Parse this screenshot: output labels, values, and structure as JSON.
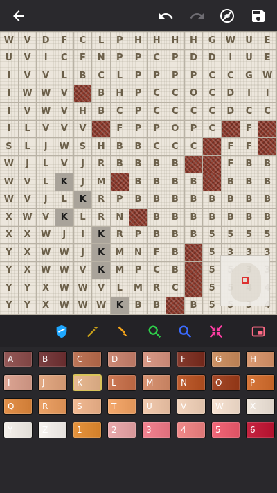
{
  "toolbar": {
    "back_icon": "arrow-left-icon",
    "undo_icon": "undo-icon",
    "redo_icon": "redo-icon",
    "hide_icon": "no-eye-icon",
    "save_icon": "save-icon"
  },
  "grid": {
    "rows": [
      [
        "W",
        "V",
        "D",
        "F",
        "C",
        "L",
        "P",
        "H",
        "H",
        "H",
        "H",
        "G",
        "W",
        "U",
        "E"
      ],
      [
        "U",
        "V",
        "I",
        "C",
        "F",
        "N",
        "P",
        "P",
        "C",
        "P",
        "D",
        "D",
        "I",
        "U",
        "E"
      ],
      [
        "I",
        "V",
        "V",
        "L",
        "B",
        "C",
        "L",
        "P",
        "P",
        "P",
        "P",
        "C",
        "C",
        "G",
        "W"
      ],
      [
        "I",
        "W",
        "W",
        "V",
        "",
        "B",
        "H",
        "P",
        "C",
        "C",
        "O",
        "C",
        "D",
        "I",
        "I"
      ],
      [
        "I",
        "V",
        "W",
        "V",
        "H",
        "B",
        "C",
        "P",
        "C",
        "C",
        "C",
        "C",
        "D",
        "C",
        "C"
      ],
      [
        "I",
        "L",
        "V",
        "V",
        "V",
        "",
        "F",
        "P",
        "P",
        "O",
        "P",
        "C",
        "",
        "F",
        ""
      ],
      [
        "S",
        "L",
        "J",
        "W",
        "S",
        "H",
        "B",
        "B",
        "C",
        "C",
        "C",
        "",
        "F",
        "F",
        ""
      ],
      [
        "W",
        "J",
        "L",
        "V",
        "J",
        "R",
        "B",
        "B",
        "B",
        "B",
        "",
        "",
        "F",
        "B",
        "B"
      ],
      [
        "W",
        "V",
        "L",
        "K",
        "J",
        "M",
        "",
        "B",
        "B",
        "B",
        "B",
        "",
        "B",
        "B",
        "B"
      ],
      [
        "W",
        "V",
        "J",
        "L",
        "K",
        "R",
        "P",
        "B",
        "B",
        "B",
        "B",
        "B",
        "B",
        "B",
        "B"
      ],
      [
        "X",
        "W",
        "V",
        "K",
        "L",
        "R",
        "N",
        "",
        "B",
        "B",
        "B",
        "B",
        "B",
        "B",
        "B"
      ],
      [
        "X",
        "X",
        "W",
        "J",
        "I",
        "K",
        "R",
        "P",
        "B",
        "B",
        "B",
        "5",
        "5",
        "5",
        "5"
      ],
      [
        "Y",
        "X",
        "W",
        "W",
        "J",
        "K",
        "M",
        "N",
        "F",
        "B",
        "",
        "5",
        "3",
        "3",
        "3"
      ],
      [
        "Y",
        "X",
        "W",
        "W",
        "V",
        "K",
        "M",
        "P",
        "C",
        "B",
        "",
        "5",
        "5",
        "3",
        "3"
      ],
      [
        "Y",
        "Y",
        "X",
        "W",
        "W",
        "V",
        "L",
        "M",
        "R",
        "C",
        "",
        "5",
        "5",
        "4",
        "4"
      ]
    ],
    "last_row": [
      "Y",
      "Y",
      "X",
      "W",
      "W",
      "W",
      "K",
      "B",
      "B",
      "",
      "B",
      "5",
      "5",
      "3",
      "4"
    ]
  },
  "palette": [
    {
      "label": "A",
      "color": "#8a4a49"
    },
    {
      "label": "B",
      "color": "#6f2f31"
    },
    {
      "label": "C",
      "color": "#b86a4a"
    },
    {
      "label": "D",
      "color": "#c77f6a"
    },
    {
      "label": "E",
      "color": "#d6917d"
    },
    {
      "label": "F",
      "color": "#7a2a1c"
    },
    {
      "label": "G",
      "color": "#c98a5a"
    },
    {
      "label": "H",
      "color": "#d89267"
    },
    {
      "label": "I",
      "color": "#d99d8a"
    },
    {
      "label": "J",
      "color": "#e0a27a"
    },
    {
      "label": "K",
      "color": "#e6b48a"
    },
    {
      "label": "L",
      "color": "#c86e47"
    },
    {
      "label": "M",
      "color": "#d58b68"
    },
    {
      "label": "N",
      "color": "#b8501f"
    },
    {
      "label": "O",
      "color": "#9c3a17"
    },
    {
      "label": "P",
      "color": "#d36b2a"
    },
    {
      "label": "Q",
      "color": "#e0873b"
    },
    {
      "label": "R",
      "color": "#ea9a5a"
    },
    {
      "label": "S",
      "color": "#f0b48a"
    },
    {
      "label": "T",
      "color": "#f4a261"
    },
    {
      "label": "U",
      "color": "#f1c6a8"
    },
    {
      "label": "V",
      "color": "#f2d1b8"
    },
    {
      "label": "W",
      "color": "#f7e1cf"
    },
    {
      "label": "X",
      "color": "#efe4d9"
    },
    {
      "label": "Y",
      "color": "#f4efe9"
    },
    {
      "label": "Z",
      "color": "#f7f3ef"
    },
    {
      "label": "1",
      "color": "#e38a2d"
    },
    {
      "label": "2",
      "color": "#e9a3a6"
    },
    {
      "label": "3",
      "color": "#f17887"
    },
    {
      "label": "4",
      "color": "#f08080"
    },
    {
      "label": "5",
      "color": "#f05a6d"
    },
    {
      "label": "6",
      "color": "#c11231"
    }
  ]
}
